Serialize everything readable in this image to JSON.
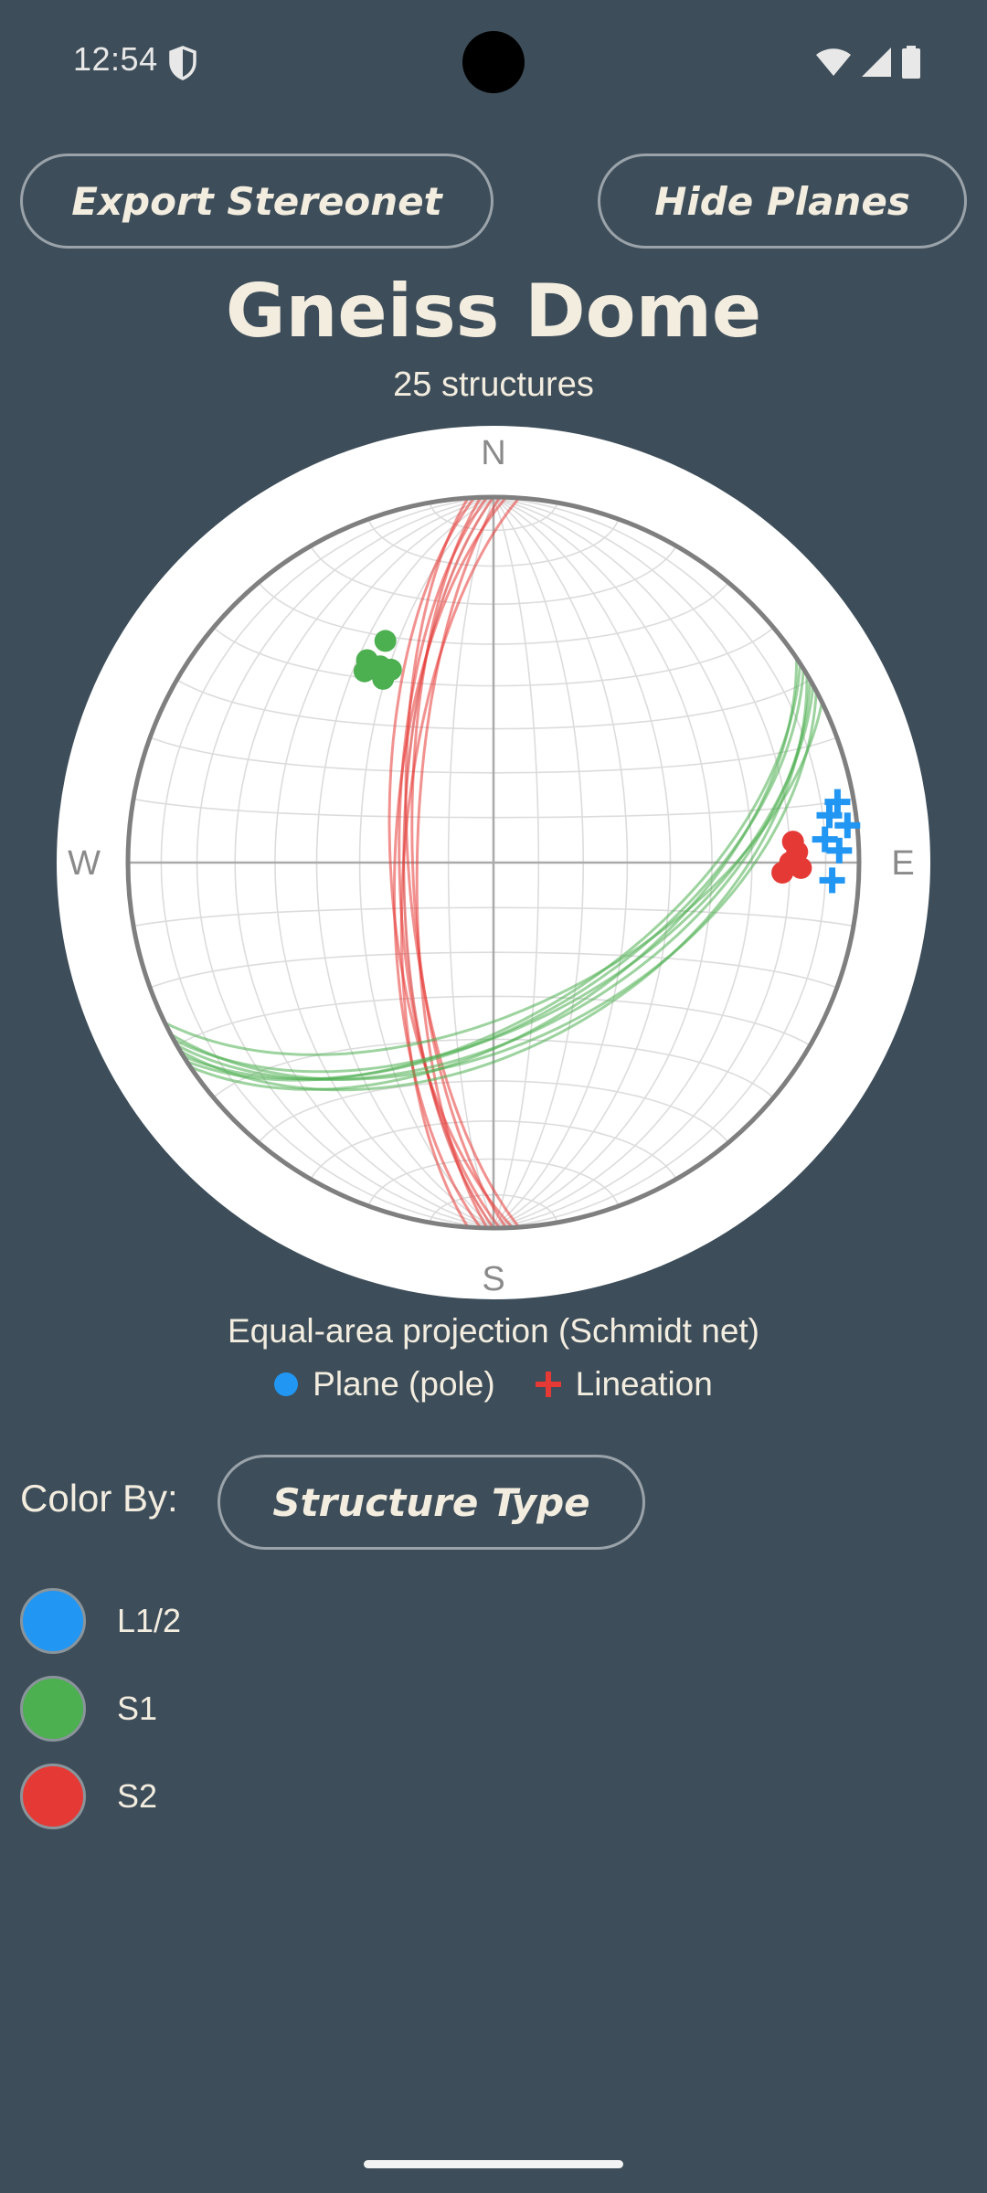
{
  "status": {
    "time": "12:54",
    "icons": [
      "shield-icon",
      "wifi-icon",
      "cell-signal-icon",
      "battery-icon"
    ]
  },
  "toolbar": {
    "export_label": "Export Stereonet",
    "hide_label": "Hide Planes"
  },
  "header": {
    "title": "Gneiss Dome",
    "subtitle": "25 structures"
  },
  "stereonet": {
    "compass": {
      "n": "N",
      "s": "S",
      "e": "E",
      "w": "W"
    },
    "caption": "Equal-area projection (Schmidt net)",
    "legend": [
      {
        "label": "Plane (pole)",
        "symbol": "dot",
        "color": "#2196f3"
      },
      {
        "label": "Lineation",
        "symbol": "cross",
        "color": "#e53935"
      }
    ]
  },
  "color_by": {
    "label": "Color By:",
    "value": "Structure Type",
    "classes": [
      {
        "label": "L1/2",
        "color": "#2196f3"
      },
      {
        "label": "S1",
        "color": "#4caf50"
      },
      {
        "label": "S2",
        "color": "#e53935"
      }
    ]
  }
}
